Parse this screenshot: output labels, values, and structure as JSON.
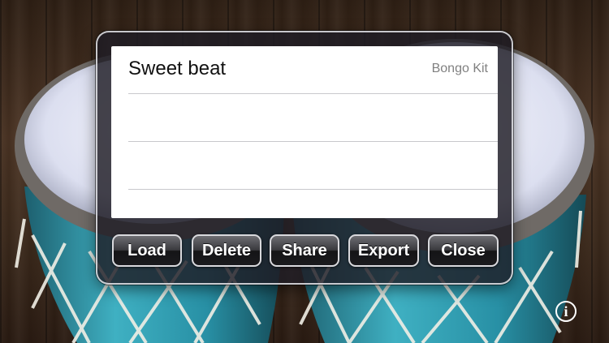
{
  "loops_list": {
    "rows": [
      {
        "title": "Sweet beat",
        "detail": "Bongo Kit"
      },
      {
        "title": "",
        "detail": ""
      },
      {
        "title": "",
        "detail": ""
      },
      {
        "title": "",
        "detail": ""
      }
    ]
  },
  "buttons": {
    "load": "Load",
    "delete": "Delete",
    "share": "Share",
    "export": "Export",
    "close": "Close"
  },
  "icons": {
    "info": "info-icon"
  },
  "colors": {
    "drum_body": "#2a8aa0",
    "drum_head": "#e6e8f4",
    "wood": "#3a2618"
  }
}
